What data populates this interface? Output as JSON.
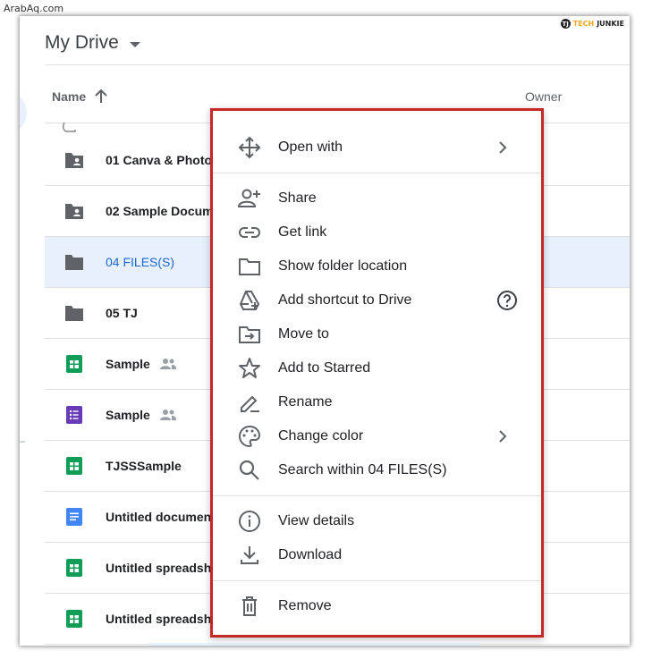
{
  "watermark": "ArabAq.com",
  "logo": {
    "mark": "TJ",
    "part1": "TECH",
    "part2": "JUNKIE"
  },
  "header": {
    "title": "My Drive"
  },
  "columns": {
    "name": "Name",
    "owner": "Owner"
  },
  "files": [
    {
      "name": "01 Canva & Photo",
      "type": "shared-folder",
      "shared": false
    },
    {
      "name": "02 Sample Docum",
      "type": "shared-folder",
      "shared": false
    },
    {
      "name": "04 FILES(S)",
      "type": "folder",
      "shared": false,
      "selected": true
    },
    {
      "name": "05 TJ",
      "type": "folder",
      "shared": false
    },
    {
      "name": "Sample",
      "type": "sheets",
      "shared": true
    },
    {
      "name": "Sample",
      "type": "forms",
      "shared": true
    },
    {
      "name": "TJSSSample",
      "type": "sheets",
      "shared": false
    },
    {
      "name": "Untitled documen",
      "type": "docs",
      "shared": false
    },
    {
      "name": "Untitled spreadsh",
      "type": "sheets",
      "shared": false
    },
    {
      "name": "Untitled spreadsh",
      "type": "sheets",
      "shared": false
    }
  ],
  "context_menu": {
    "open_with": "Open with",
    "share": "Share",
    "get_link": "Get link",
    "show_folder_location": "Show folder location",
    "add_shortcut": "Add shortcut to Drive",
    "move_to": "Move to",
    "add_starred": "Add to Starred",
    "rename": "Rename",
    "change_color": "Change color",
    "search_within": "Search within 04 FILES(S)",
    "view_details": "View details",
    "download": "Download",
    "remove": "Remove"
  },
  "colors": {
    "highlight_border": "#c62828",
    "selected_row": "#e8f0fe",
    "folder": "#5f6368",
    "sheets": "#0f9d58",
    "forms": "#673ab7",
    "docs": "#4285f4"
  }
}
